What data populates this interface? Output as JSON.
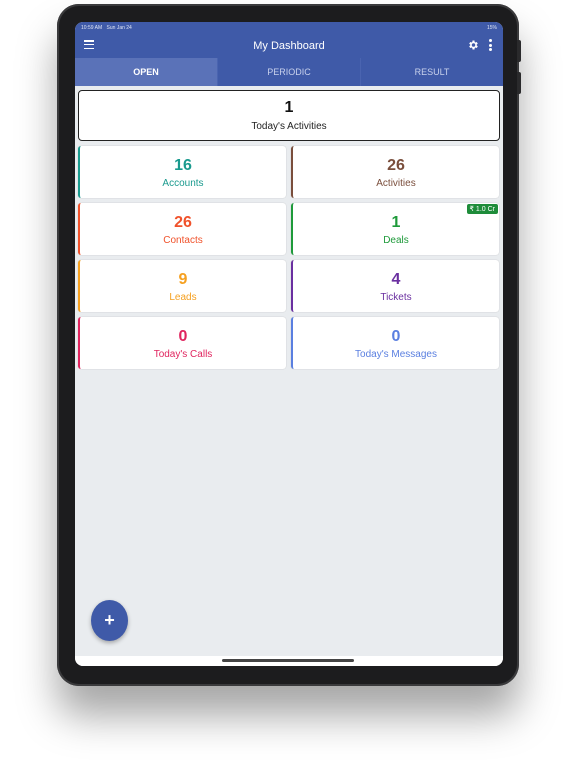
{
  "statusbar": {
    "time": "10:59 AM",
    "date": "Sun Jan 24",
    "battery": "15%"
  },
  "appbar": {
    "title": "My Dashboard"
  },
  "tabs": [
    {
      "label": "OPEN"
    },
    {
      "label": "PERIODIC"
    },
    {
      "label": "RESULT"
    }
  ],
  "hero": {
    "value": "1",
    "label": "Today's Activities"
  },
  "cards": [
    {
      "value": "16",
      "label": "Accounts",
      "color": "#1a9a8e"
    },
    {
      "value": "26",
      "label": "Activities",
      "color": "#7a4e3c"
    },
    {
      "value": "26",
      "label": "Contacts",
      "color": "#f0522b"
    },
    {
      "value": "1",
      "label": "Deals",
      "color": "#1e9a3a",
      "badge": "₹ 1.0 Cr"
    },
    {
      "value": "9",
      "label": "Leads",
      "color": "#f5a020"
    },
    {
      "value": "4",
      "label": "Tickets",
      "color": "#6a2fa0"
    },
    {
      "value": "0",
      "label": "Today's Calls",
      "color": "#e0245e"
    },
    {
      "value": "0",
      "label": "Today's Messages",
      "color": "#5a7fe0"
    }
  ],
  "fab": {
    "label": "+"
  },
  "colors": {
    "primary": "#3f5aa8",
    "background": "#e9ecef"
  },
  "icons": [
    "menu-icon",
    "gear-icon",
    "more-vertical-icon",
    "plus-icon"
  ]
}
